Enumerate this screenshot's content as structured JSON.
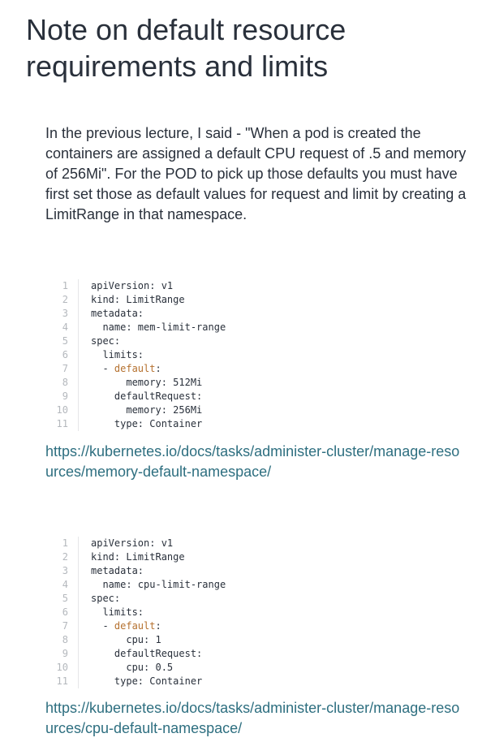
{
  "title": "Note on default resource requirements and limits",
  "intro": "In the previous lecture, I said - \"When a pod is created the containers are assigned a default CPU request of .5 and memory of 256Mi\". For the POD to pick up those defaults you must have first set those as default values for request and limit by creating a LimitRange in that namespace.",
  "code_blocks": [
    {
      "lines": [
        {
          "n": "1",
          "pre": "apiVersion: v1",
          "kw": "",
          "post": ""
        },
        {
          "n": "2",
          "pre": "kind: LimitRange",
          "kw": "",
          "post": ""
        },
        {
          "n": "3",
          "pre": "metadata:",
          "kw": "",
          "post": ""
        },
        {
          "n": "4",
          "pre": "  name: mem-limit-range",
          "kw": "",
          "post": ""
        },
        {
          "n": "5",
          "pre": "spec:",
          "kw": "",
          "post": ""
        },
        {
          "n": "6",
          "pre": "  limits:",
          "kw": "",
          "post": ""
        },
        {
          "n": "7",
          "pre": "  - ",
          "kw": "default",
          "post": ":"
        },
        {
          "n": "8",
          "pre": "      memory: 512Mi",
          "kw": "",
          "post": ""
        },
        {
          "n": "9",
          "pre": "    defaultRequest:",
          "kw": "",
          "post": ""
        },
        {
          "n": "10",
          "pre": "      memory: 256Mi",
          "kw": "",
          "post": ""
        },
        {
          "n": "11",
          "pre": "    type: Container",
          "kw": "",
          "post": ""
        }
      ]
    },
    {
      "lines": [
        {
          "n": "1",
          "pre": "apiVersion: v1",
          "kw": "",
          "post": ""
        },
        {
          "n": "2",
          "pre": "kind: LimitRange",
          "kw": "",
          "post": ""
        },
        {
          "n": "3",
          "pre": "metadata:",
          "kw": "",
          "post": ""
        },
        {
          "n": "4",
          "pre": "  name: cpu-limit-range",
          "kw": "",
          "post": ""
        },
        {
          "n": "5",
          "pre": "spec:",
          "kw": "",
          "post": ""
        },
        {
          "n": "6",
          "pre": "  limits:",
          "kw": "",
          "post": ""
        },
        {
          "n": "7",
          "pre": "  - ",
          "kw": "default",
          "post": ":"
        },
        {
          "n": "8",
          "pre": "      cpu: 1",
          "kw": "",
          "post": ""
        },
        {
          "n": "9",
          "pre": "    defaultRequest:",
          "kw": "",
          "post": ""
        },
        {
          "n": "10",
          "pre": "      cpu: 0.5",
          "kw": "",
          "post": ""
        },
        {
          "n": "11",
          "pre": "    type: Container",
          "kw": "",
          "post": ""
        }
      ]
    }
  ],
  "links": [
    {
      "text": "https://kubernetes.io/docs/tasks/administer-cluster/manage-resources/memory-default-namespace/"
    },
    {
      "text": "https://kubernetes.io/docs/tasks/administer-cluster/manage-resources/cpu-default-namespace/"
    }
  ],
  "colors": {
    "text": "#29303b",
    "link": "#2e6f80",
    "keyword": "#b5712f",
    "line_number": "#b4b8bd"
  }
}
